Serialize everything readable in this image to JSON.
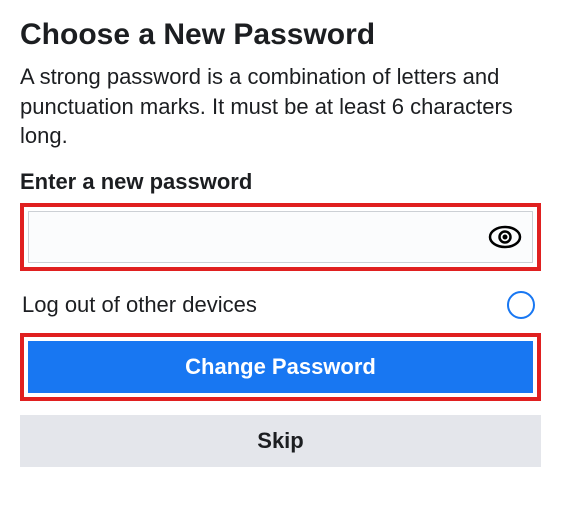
{
  "header": {
    "title": "Choose a New Password",
    "description": "A strong password is a combination of letters and punctuation marks. It must be at least 6 characters long."
  },
  "form": {
    "password_label": "Enter a new password",
    "password_value": "",
    "password_placeholder": "",
    "logout_label": "Log out of other devices",
    "logout_selected": false
  },
  "actions": {
    "primary_label": "Change Password",
    "secondary_label": "Skip"
  },
  "colors": {
    "highlight": "#e02020",
    "primary": "#1877f2",
    "secondary_bg": "#e4e6eb"
  }
}
